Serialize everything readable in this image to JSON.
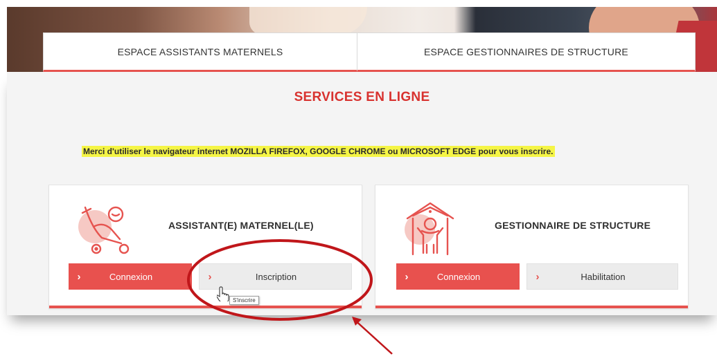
{
  "tabs": [
    {
      "label": "ESPACE ASSISTANTS MATERNELS"
    },
    {
      "label": "ESPACE GESTIONNAIRES DE STRUCTURE"
    }
  ],
  "section": {
    "title": "SERVICES EN LIGNE",
    "notice": "Merci d'utiliser le navigateur internet MOZILLA FIREFOX, GOOGLE CHROME ou MICROSOFT EDGE pour vous inscrire."
  },
  "cards": [
    {
      "title": "ASSISTANT(E) MATERNEL(LE)",
      "icon": "stroller-baby-icon",
      "buttons": [
        {
          "label": "Connexion",
          "chevron": "›"
        },
        {
          "label": "Inscription",
          "chevron": "›"
        }
      ]
    },
    {
      "title": "GESTIONNAIRE DE STRUCTURE",
      "icon": "house-child-icon",
      "buttons": [
        {
          "label": "Connexion",
          "chevron": "›"
        },
        {
          "label": "Habilitation",
          "chevron": "›"
        }
      ]
    }
  ],
  "tooltip": "S'inscrire",
  "colors": {
    "accent": "#e8514e",
    "title_red": "#d8322f",
    "highlight": "#f5f545",
    "annotation": "#c0161a"
  }
}
